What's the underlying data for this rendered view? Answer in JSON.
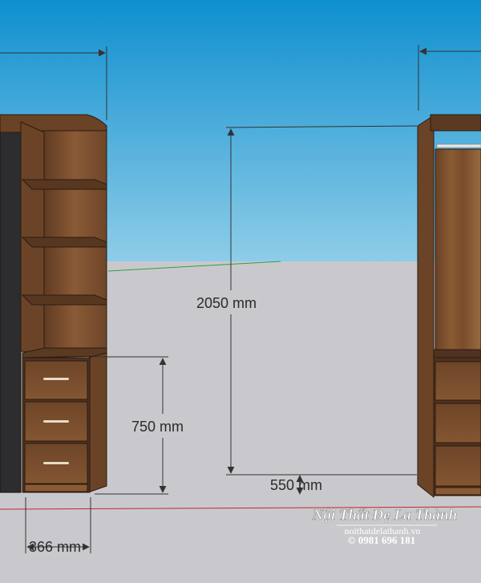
{
  "dimensions": {
    "height_total": "2050 mm",
    "height_lower": "750 mm",
    "gap_width": "550 mm",
    "cabinet_depth": "366 mm"
  },
  "watermark": {
    "brand": "Nội Thất Đẹ La Thành",
    "website": "noithatdelathanh.vn",
    "phone": "© 0981 696 181"
  },
  "colors": {
    "sky_top": "#0f8fcf",
    "sky_bottom": "#8fcde8",
    "floor": "#c9c9cd",
    "wood": "#7a4e2c",
    "wood_dark": "#4f3220",
    "door_dark": "#2d2d2f",
    "dimension_line": "#333333"
  }
}
